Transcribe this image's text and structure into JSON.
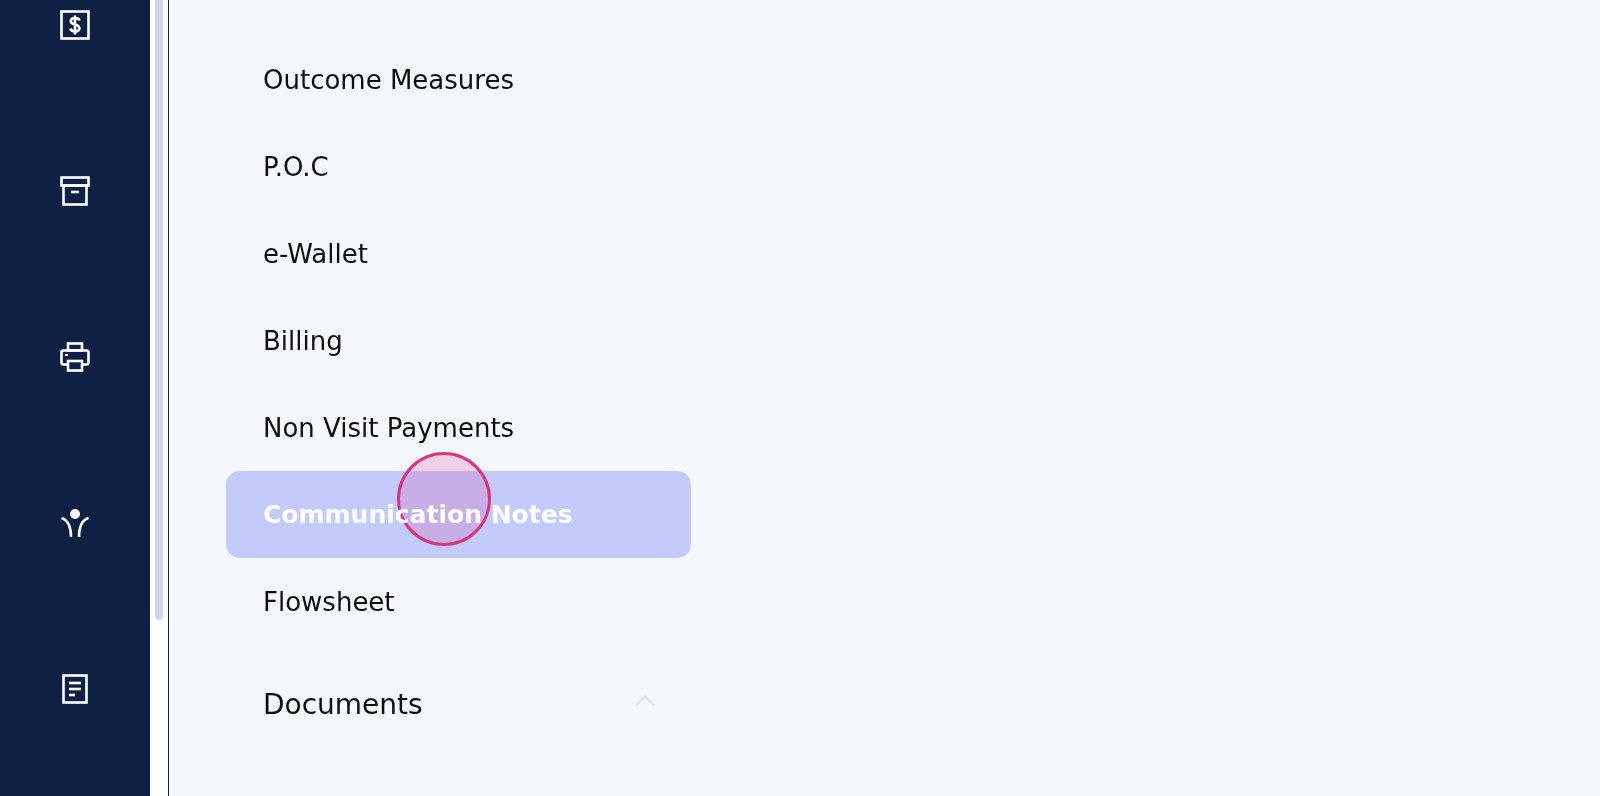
{
  "menu": {
    "items": [
      {
        "label": "Outcome Measures",
        "selected": false
      },
      {
        "label": "P.O.C",
        "selected": false
      },
      {
        "label": "e-Wallet",
        "selected": false
      },
      {
        "label": "Billing",
        "selected": false
      },
      {
        "label": "Non Visit Payments",
        "selected": false
      },
      {
        "label": "Communication Notes",
        "selected": true
      },
      {
        "label": "Flowsheet",
        "selected": false
      }
    ]
  },
  "documents_section": {
    "title": "Documents",
    "expanded": true
  },
  "click_indicator": {
    "visible": true
  }
}
